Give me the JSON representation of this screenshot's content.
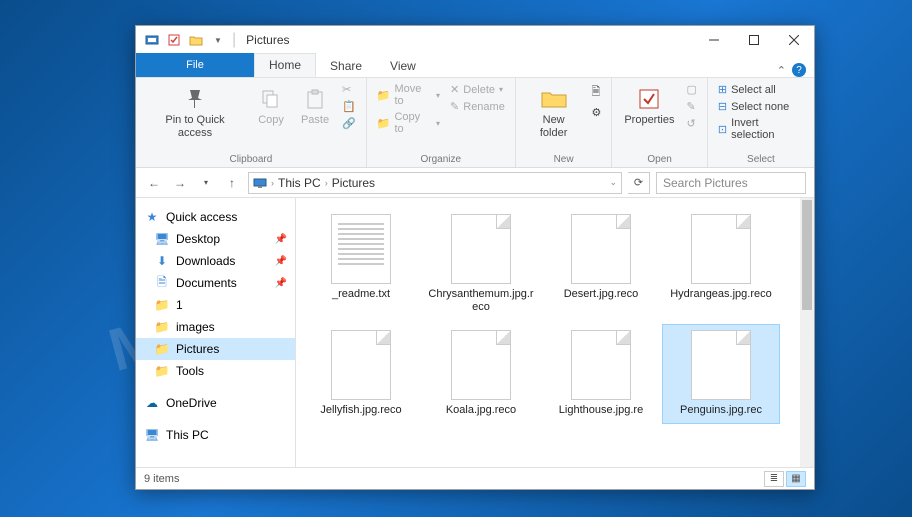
{
  "title": "Pictures",
  "tabs": {
    "file": "File",
    "home": "Home",
    "share": "Share",
    "view": "View"
  },
  "ribbon": {
    "clipboard": {
      "label": "Clipboard",
      "pin": "Pin to Quick access",
      "copy": "Copy",
      "paste": "Paste"
    },
    "organize": {
      "label": "Organize",
      "moveto": "Move to",
      "copyto": "Copy to",
      "delete": "Delete",
      "rename": "Rename"
    },
    "new": {
      "label": "New",
      "newfolder": "New folder"
    },
    "open": {
      "label": "Open",
      "properties": "Properties"
    },
    "select": {
      "label": "Select",
      "all": "Select all",
      "none": "Select none",
      "invert": "Invert selection"
    }
  },
  "address": {
    "root": "This PC",
    "folder": "Pictures"
  },
  "search": {
    "placeholder": "Search Pictures"
  },
  "sidebar": {
    "quick": "Quick access",
    "items": [
      {
        "label": "Desktop"
      },
      {
        "label": "Downloads"
      },
      {
        "label": "Documents"
      },
      {
        "label": "1"
      },
      {
        "label": "images"
      },
      {
        "label": "Pictures"
      },
      {
        "label": "Tools"
      }
    ],
    "onedrive": "OneDrive",
    "thispc": "This PC"
  },
  "files": [
    {
      "name": "_readme.txt",
      "type": "txt"
    },
    {
      "name": "Chrysanthemum.jpg.reco",
      "type": "blank"
    },
    {
      "name": "Desert.jpg.reco",
      "type": "blank"
    },
    {
      "name": "Hydrangeas.jpg.reco",
      "type": "blank"
    },
    {
      "name": "Jellyfish.jpg.reco",
      "type": "blank"
    },
    {
      "name": "Koala.jpg.reco",
      "type": "blank"
    },
    {
      "name": "Lighthouse.jpg.re",
      "type": "blank"
    },
    {
      "name": "Penguins.jpg.rec",
      "type": "blank",
      "selected": true
    }
  ],
  "status": {
    "count": "9 items"
  }
}
